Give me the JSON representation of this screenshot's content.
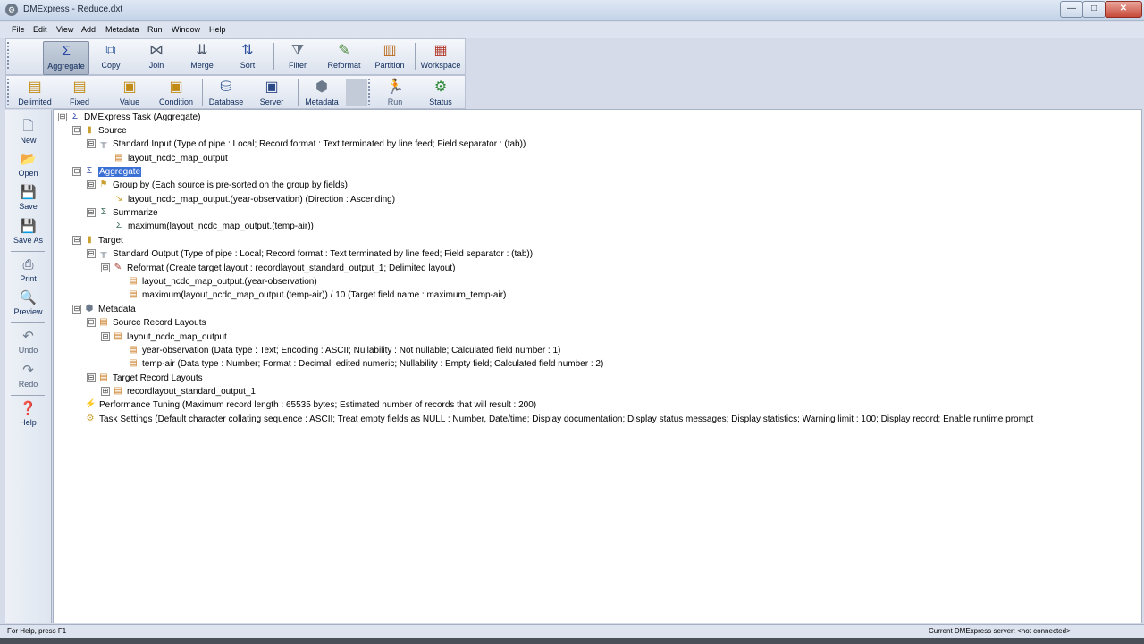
{
  "window": {
    "title": "DMExpress - Reduce.dxt",
    "minimize": "—",
    "maximize": "□",
    "close": "✕"
  },
  "menu": [
    "File",
    "Edit",
    "View",
    "Add",
    "Metadata",
    "Run",
    "Window",
    "Help"
  ],
  "toolbar1": [
    {
      "label": "Aggregate",
      "icon": "sigma-icon",
      "glyph": "Σ",
      "color": "#2a48a6"
    },
    {
      "label": "Copy",
      "icon": "copy-icon",
      "glyph": "⧉",
      "color": "#4a6ea8"
    },
    {
      "label": "Join",
      "icon": "join-icon",
      "glyph": "⋈",
      "color": "#4f5b6d"
    },
    {
      "label": "Merge",
      "icon": "merge-icon",
      "glyph": "⇊",
      "color": "#4f5b6d"
    },
    {
      "label": "Sort",
      "icon": "sort-icon",
      "glyph": "⇅",
      "color": "#2b4e9b"
    },
    {
      "label": "Filter",
      "icon": "filter-icon",
      "glyph": "⧩",
      "color": "#6b7787"
    },
    {
      "label": "Reformat",
      "icon": "reformat-icon",
      "glyph": "✎",
      "color": "#4a8a3a"
    },
    {
      "label": "Partition",
      "icon": "partition-icon",
      "glyph": "▥",
      "color": "#b86a1a"
    },
    {
      "label": "Workspace",
      "icon": "workspace-icon",
      "glyph": "▦",
      "color": "#b23a2a"
    }
  ],
  "toolbar2": [
    {
      "label": "Delimited",
      "icon": "delimited-layout-icon",
      "glyph": "▤",
      "color": "#c28b15"
    },
    {
      "label": "Fixed",
      "icon": "fixed-layout-icon",
      "glyph": "▤",
      "color": "#c28b15"
    },
    {
      "label": "Value",
      "icon": "value-icon",
      "glyph": "▣",
      "color": "#c28b15"
    },
    {
      "label": "Condition",
      "icon": "condition-icon",
      "glyph": "▣",
      "color": "#c28b15"
    },
    {
      "label": "Database",
      "icon": "database-icon",
      "glyph": "⛁",
      "color": "#3a5f9a"
    },
    {
      "label": "Server",
      "icon": "server-icon",
      "glyph": "▣",
      "color": "#2c4a86"
    },
    {
      "label": "Metadata",
      "icon": "metadata-icon",
      "glyph": "⬢",
      "color": "#6c7a8c"
    },
    {
      "label": "Run",
      "icon": "run-icon",
      "glyph": "🏃",
      "color": "#6c7a8c"
    },
    {
      "label": "Status",
      "icon": "status-icon",
      "glyph": "⚙",
      "color": "#2f8a3a"
    }
  ],
  "sidebar": [
    {
      "label": "New",
      "icon": "new-file-icon",
      "glyph": "🗋",
      "color": "#5a6b85"
    },
    {
      "label": "Open",
      "icon": "open-folder-icon",
      "glyph": "📂",
      "color": "#c9a030"
    },
    {
      "label": "Save",
      "icon": "save-icon",
      "glyph": "💾",
      "color": "#3b4a66"
    },
    {
      "label": "Save As",
      "icon": "save-as-icon",
      "glyph": "💾",
      "color": "#3b4a66"
    },
    {
      "label": "Print",
      "icon": "print-icon",
      "glyph": "⎙",
      "color": "#3b4a66"
    },
    {
      "label": "Preview",
      "icon": "preview-icon",
      "glyph": "🔍",
      "color": "#3b4a66"
    },
    {
      "label": "Undo",
      "icon": "undo-icon",
      "glyph": "↶",
      "color": "#6c7a8c"
    },
    {
      "label": "Redo",
      "icon": "redo-icon",
      "glyph": "↷",
      "color": "#6c7a8c"
    },
    {
      "label": "Help",
      "icon": "help-icon",
      "glyph": "❓",
      "color": "#3b4a66"
    }
  ],
  "tree": [
    {
      "text": "DMExpress Task    (Aggregate)",
      "icon": "task-icon",
      "glyph": "Σ",
      "color": "#2a48a6",
      "toggle": "⊟"
    },
    {
      "text": "Source",
      "icon": "source-icon",
      "glyph": "▮",
      "color": "#c9a030",
      "toggle": "⊟"
    },
    {
      "text": "Standard Input    (Type of pipe : Local;    Record format : Text terminated by line feed;    Field separator : (tab))",
      "icon": "pipe-icon",
      "glyph": "╥",
      "color": "#6a7585",
      "toggle": "⊟"
    },
    {
      "text": "layout_ncdc_map_output",
      "icon": "layout-icon",
      "glyph": "▤",
      "color": "#c97a20",
      "toggle": ""
    },
    {
      "text": "Aggregate",
      "icon": "aggregate-node-icon",
      "glyph": "Σ",
      "color": "#2a48a6",
      "toggle": "⊟"
    },
    {
      "text": "Group by    (Each source is pre-sorted on the group by fields)",
      "icon": "group-by-icon",
      "glyph": "⚑",
      "color": "#c9a030",
      "toggle": "⊟"
    },
    {
      "text": "layout_ncdc_map_output.(year-observation)    (Direction : Ascending)",
      "icon": "field-icon",
      "glyph": "↘",
      "color": "#c9a030",
      "toggle": ""
    },
    {
      "text": "Summarize",
      "icon": "summarize-icon",
      "glyph": "Σ",
      "color": "#3a6a5a",
      "toggle": "⊟"
    },
    {
      "text": "maximum(layout_ncdc_map_output.(temp-air))",
      "icon": "summary-field-icon",
      "glyph": "Σ",
      "color": "#3a6a5a",
      "toggle": ""
    },
    {
      "text": "Target",
      "icon": "target-icon",
      "glyph": "▮",
      "color": "#c9a030",
      "toggle": "⊟"
    },
    {
      "text": "Standard Output    (Type of pipe : Local;    Record format : Text terminated by line feed;    Field separator : (tab))",
      "icon": "pipe-icon",
      "glyph": "╥",
      "color": "#6a7585",
      "toggle": "⊟"
    },
    {
      "text": "Reformat    (Create target layout : recordlayout_standard_output_1;    Delimited layout)",
      "icon": "reformat-node-icon",
      "glyph": "✎",
      "color": "#a03a2a",
      "toggle": "⊟"
    },
    {
      "text": "layout_ncdc_map_output.(year-observation)",
      "icon": "layout-icon",
      "glyph": "▤",
      "color": "#c97a20",
      "toggle": ""
    },
    {
      "text": "maximum(layout_ncdc_map_output.(temp-air)) / 10    (Target field name : maximum_temp-air)",
      "icon": "layout-icon",
      "glyph": "▤",
      "color": "#c97a20",
      "toggle": ""
    },
    {
      "text": "Metadata",
      "icon": "metadata-node-icon",
      "glyph": "⬢",
      "color": "#6c7a8c",
      "toggle": "⊟"
    },
    {
      "text": "Source Record Layouts",
      "icon": "record-layouts-icon",
      "glyph": "▤",
      "color": "#c97a20",
      "toggle": "⊟"
    },
    {
      "text": "layout_ncdc_map_output",
      "icon": "layout-icon",
      "glyph": "▤",
      "color": "#c97a20",
      "toggle": "⊟"
    },
    {
      "text": "year-observation    (Data type : Text;    Encoding : ASCII;    Nullability : Not nullable;    Calculated field number : 1)",
      "icon": "layout-icon",
      "glyph": "▤",
      "color": "#c97a20",
      "toggle": ""
    },
    {
      "text": "temp-air    (Data type : Number;    Format : Decimal, edited numeric;    Nullability : Empty field;    Calculated field number : 2)",
      "icon": "layout-icon",
      "glyph": "▤",
      "color": "#c97a20",
      "toggle": ""
    },
    {
      "text": "Target Record Layouts",
      "icon": "record-layouts-icon",
      "glyph": "▤",
      "color": "#c97a20",
      "toggle": "⊟"
    },
    {
      "text": "recordlayout_standard_output_1",
      "icon": "layout-icon",
      "glyph": "▤",
      "color": "#c97a20",
      "toggle": "⊞"
    },
    {
      "text": "Performance Tuning    (Maximum record length : 65535 bytes;    Estimated number of records that will result : 200)",
      "icon": "tuning-icon",
      "glyph": "⚡",
      "color": "#c9a030",
      "toggle": ""
    },
    {
      "text": "Task Settings    (Default character collating sequence : ASCII;    Treat empty fields as NULL : Number, Date/time;    Display documentation;    Display status messages;    Display statistics;    Warning limit : 100;    Display record;    Enable runtime prompt",
      "icon": "settings-icon",
      "glyph": "⚙",
      "color": "#c9a030",
      "toggle": ""
    }
  ],
  "status": {
    "left": "For Help, press F1",
    "right": "Current DMExpress server: <not connected>"
  },
  "colors": {
    "selection": "#3a6fd4",
    "toolbar_label": "#0e2a5a"
  }
}
